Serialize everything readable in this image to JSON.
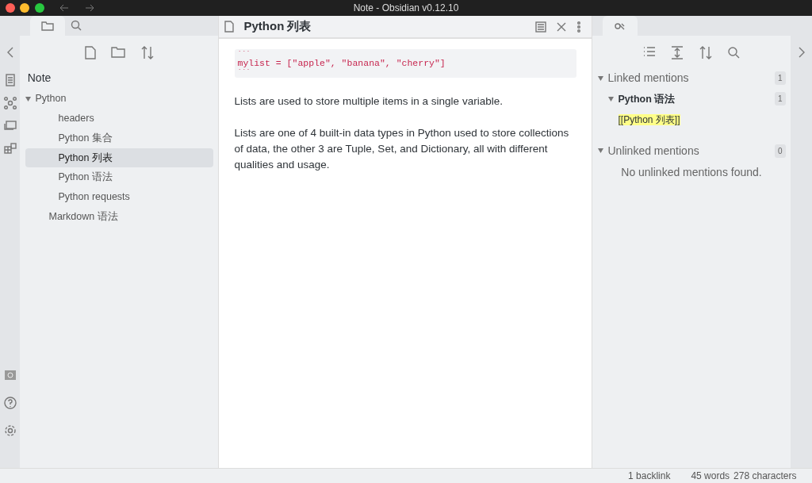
{
  "window": {
    "title": "Note - Obsidian v0.12.10"
  },
  "left_panel": {
    "vault": "Note",
    "tree": [
      {
        "label": "Python",
        "kind": "folder",
        "expanded": true,
        "selected": false,
        "children": [
          {
            "label": "headers",
            "kind": "file",
            "selected": false
          },
          {
            "label": "Python 集合",
            "kind": "file",
            "selected": false
          },
          {
            "label": "Python 列表",
            "kind": "file",
            "selected": true
          },
          {
            "label": "Python 语法",
            "kind": "file",
            "selected": false
          },
          {
            "label": "Python requests",
            "kind": "file",
            "selected": false
          }
        ]
      },
      {
        "label": "Markdown 语法",
        "kind": "file",
        "selected": false
      }
    ]
  },
  "editor": {
    "title": "Python 列表",
    "code_lines": [
      "```",
      "mylist = [\"apple\", \"banana\", \"cherry\"]",
      "```"
    ],
    "paragraphs": [
      "Lists are used to store multiple items in a single variable.",
      "Lists are one of 4 built-in data types in Python used to store collections of data, the other 3 are Tuple, Set, and Dictionary, all with different qualities and usage."
    ]
  },
  "backlinks": {
    "sections": [
      {
        "title": "Linked mentions",
        "count": "1",
        "expanded": true,
        "groups": [
          {
            "title": "Python 语法",
            "count": "1",
            "expanded": true,
            "matches": [
              "[[Python 列表]]"
            ]
          }
        ]
      },
      {
        "title": "Unlinked mentions",
        "count": "0",
        "expanded": true,
        "empty_text": "No unlinked mentions found."
      }
    ]
  },
  "status_bar": [
    "1 backlink",
    "45 words",
    "278 characters"
  ]
}
